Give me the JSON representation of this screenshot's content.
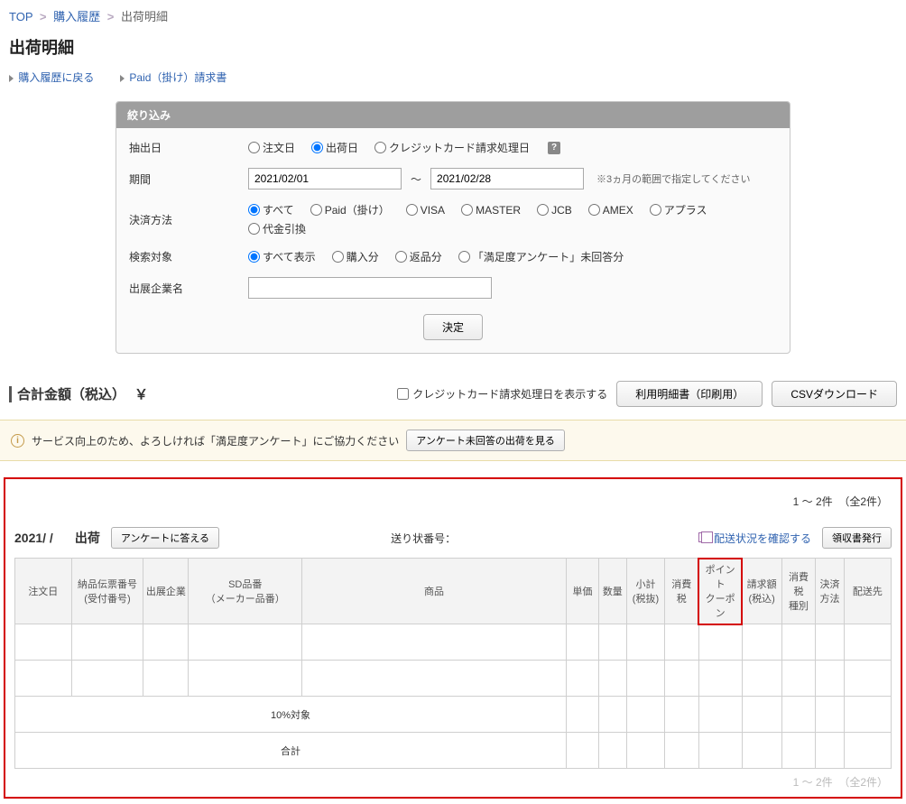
{
  "breadcrumb": {
    "top": "TOP",
    "history": "購入履歴",
    "current": "出荷明細"
  },
  "page_title": "出荷明細",
  "sub_links": {
    "back": "購入履歴に戻る",
    "paid_invoice": "Paid（掛け）請求書"
  },
  "filter": {
    "header": "絞り込み",
    "extract_date": {
      "label": "抽出日",
      "opts": [
        "注文日",
        "出荷日",
        "クレジットカード請求処理日"
      ],
      "tooltip": "?"
    },
    "period": {
      "label": "期間",
      "from": "2021/02/01",
      "to": "2021/02/28",
      "tilde": "～",
      "note": "※3ヵ月の範囲で指定してください"
    },
    "payment": {
      "label": "決済方法",
      "opts": [
        "すべて",
        "Paid（掛け）",
        "VISA",
        "MASTER",
        "JCB",
        "AMEX",
        "アプラス",
        "代金引換"
      ]
    },
    "target": {
      "label": "検索対象",
      "opts": [
        "すべて表示",
        "購入分",
        "返品分",
        "「満足度アンケート」未回答分"
      ]
    },
    "company": {
      "label": "出展企業名"
    },
    "submit": "決定"
  },
  "total": {
    "label": "合計金額（税込）",
    "yen": "￥",
    "show_cc_checkbox": "クレジットカード請求処理日を表示する",
    "print_btn": "利用明細書（印刷用）",
    "csv_btn": "CSVダウンロード"
  },
  "notice": {
    "icon": "i",
    "text": "サービス向上のため、よろしければ「満足度アンケート」にご協力ください",
    "btn": "アンケート未回答の出荷を見る"
  },
  "count": {
    "range": "1 ～ 2件",
    "total": "（全2件）"
  },
  "shipment": {
    "date": "2021/  /",
    "status": "出荷",
    "survey_btn": "アンケートに答える",
    "tracking_label": "送り状番号：",
    "check_delivery": "配送状況を確認する",
    "receipt_btn": "領収書発行"
  },
  "table": {
    "headers": [
      "注文日",
      "納品伝票番号\n(受付番号)",
      "出展企業",
      "SD品番\n（メーカー品番）",
      "商品",
      "単価",
      "数量",
      "小計\n(税抜)",
      "消費税",
      "ポイント\nクーポン",
      "請求額\n(税込)",
      "消費税\n種別",
      "決済\n方法",
      "配送先"
    ],
    "col_widths": [
      "60",
      "76",
      "48",
      "120",
      "280",
      "34",
      "30",
      "40",
      "36",
      "46",
      "42",
      "36",
      "30",
      "50"
    ],
    "tax_row_label": "10%対象",
    "total_row_label": "合計"
  }
}
